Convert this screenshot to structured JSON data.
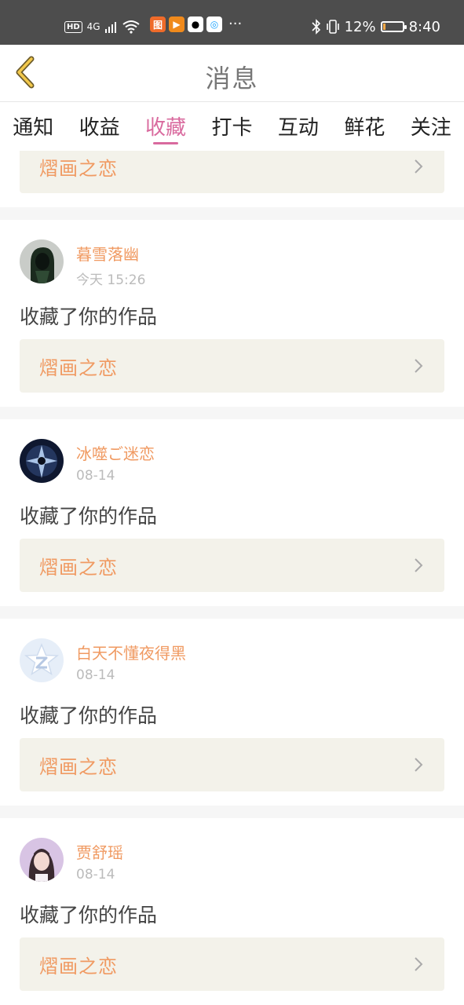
{
  "status_bar": {
    "hd": "HD",
    "network": "4G",
    "battery_text": "12%",
    "time": "8:40",
    "battery_level": 0.12,
    "more": "···"
  },
  "header": {
    "title": "消息"
  },
  "tabs": [
    {
      "label": "通知",
      "active": false
    },
    {
      "label": "收益",
      "active": false
    },
    {
      "label": "收藏",
      "active": true
    },
    {
      "label": "打卡",
      "active": false
    },
    {
      "label": "互动",
      "active": false
    },
    {
      "label": "鲜花",
      "active": false
    },
    {
      "label": "关注",
      "active": false
    }
  ],
  "partial_card": {
    "work_title": "熠画之恋"
  },
  "cards": [
    {
      "user": "暮雪落幽",
      "time": "今天 15:26",
      "action": "收藏了你的作品",
      "work_title": "熠画之恋",
      "avatar_icon": "avatar-dark-hooded"
    },
    {
      "user": "冰噬ご迷恋",
      "time": "08-14",
      "action": "收藏了你的作品",
      "work_title": "熠画之恋",
      "avatar_icon": "avatar-dark-armor"
    },
    {
      "user": "白天不懂夜得黑",
      "time": "08-14",
      "action": "收藏了你的作品",
      "work_title": "熠画之恋",
      "avatar_icon": "avatar-qzone-star"
    },
    {
      "user": "贾舒瑶",
      "time": "08-14",
      "action": "收藏了你的作品",
      "work_title": "熠画之恋",
      "avatar_icon": "avatar-girl-photo"
    }
  ],
  "colors": {
    "accent": "#d96a9e",
    "work_text": "#f09a62",
    "work_bg": "#f3f2ea",
    "status_bar": "#4d4d4d"
  }
}
